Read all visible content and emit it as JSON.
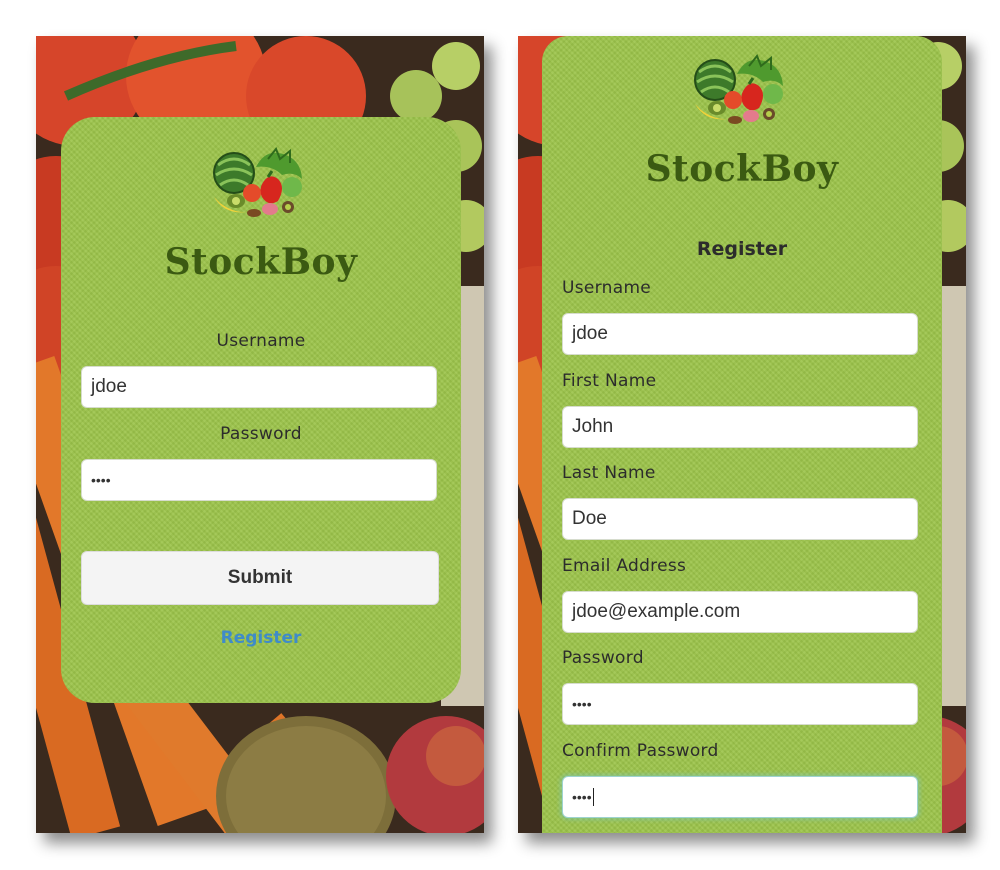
{
  "app": {
    "name": "StockBoy"
  },
  "login": {
    "username_label": "Username",
    "username_value": "jdoe",
    "password_label": "Password",
    "password_value": "••••",
    "submit_label": "Submit",
    "register_link": "Register"
  },
  "register": {
    "title": "Register",
    "username_label": "Username",
    "username_value": "jdoe",
    "first_name_label": "First Name",
    "first_name_value": "John",
    "last_name_label": "Last Name",
    "last_name_value": "Doe",
    "email_label": "Email Address",
    "email_value": "jdoe@example.com",
    "password_label": "Password",
    "password_value": "••••",
    "confirm_label": "Confirm Password",
    "confirm_value": "••••"
  },
  "icons": {
    "logo": "vegetables-basket-icon"
  },
  "colors": {
    "card_green": "#9cc44a",
    "brand_text": "#3b5a12",
    "link": "#3f8bc9"
  }
}
